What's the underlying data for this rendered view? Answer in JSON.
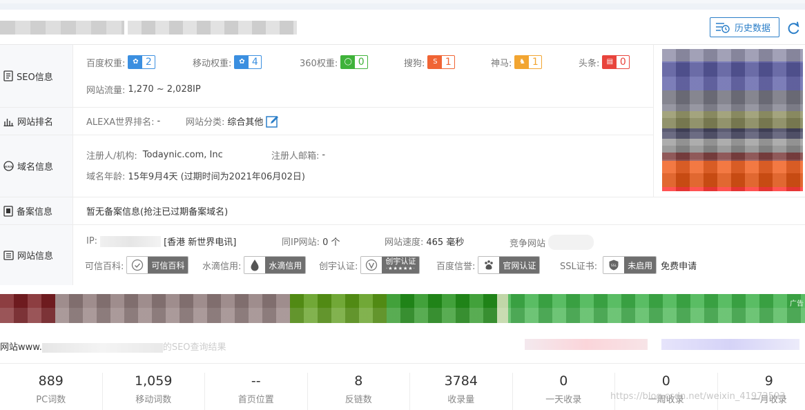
{
  "header": {
    "history_button": "历史数据",
    "icons": {
      "history": "history-list-icon",
      "refresh": "refresh-icon"
    }
  },
  "rows": {
    "seo": {
      "label": "SEO信息",
      "baidu_label": "百度权重:",
      "baidu_value": "2",
      "mobile_label": "移动权重:",
      "mobile_value": "4",
      "r360_label": "360权重:",
      "r360_value": "0",
      "sogou_label": "搜狗:",
      "sogou_value": "1",
      "shenma_label": "神马:",
      "shenma_value": "1",
      "toutiao_label": "头条:",
      "toutiao_value": "0",
      "traffic_label": "网站流量:",
      "traffic_value": "1,270 ~ 2,028IP"
    },
    "ranking": {
      "label": "网站排名",
      "alexa_label": "ALEXA世界排名:",
      "alexa_value": "-",
      "category_label": "网站分类:",
      "category_value": "综合其他"
    },
    "domain": {
      "label": "域名信息",
      "registrant_label": "注册人/机构:",
      "registrant_value": "Todaynic.com, Inc",
      "email_label": "注册人邮箱:",
      "email_value": "-",
      "age_label": "域名年龄:",
      "age_value": "15年9月4天 (过期时间为2021年06月02日)"
    },
    "icp": {
      "label": "备案信息",
      "value": "暂无备案信息(抢注已过期备案域名)"
    },
    "site": {
      "label": "网站信息",
      "ip_label": "IP:",
      "ip_location": "[香港 新世界电讯]",
      "same_ip_label": "同IP网站:",
      "same_ip_value": "0 个",
      "speed_label": "网站速度:",
      "speed_value": "465 毫秒",
      "compete_label": "竞争网站",
      "trust_label": "可信百科:",
      "trust_badge": "可信百科",
      "shuidi_label": "水滴信用:",
      "shuidi_badge": "水滴信用",
      "chuangyu_label": "创宇认证:",
      "chuangyu_badge": "创宇认证",
      "baidu_credit_label": "百度信誉:",
      "baidu_credit_badge": "官网认证",
      "ssl_label": "SSL证书:",
      "ssl_badge": "未启用",
      "ssl_apply": "免费申请"
    }
  },
  "result": {
    "prefix": "网站www.",
    "suffix": "的SEO查询结果"
  },
  "ad": {
    "tag": "广告"
  },
  "stats": [
    {
      "value": "889",
      "label": "PC词数"
    },
    {
      "value": "1,059",
      "label": "移动词数"
    },
    {
      "value": "--",
      "label": "首页位置"
    },
    {
      "value": "8",
      "label": "反链数"
    },
    {
      "value": "3784",
      "label": "收录量"
    },
    {
      "value": "0",
      "label": "一天收录"
    },
    {
      "value": "0",
      "label": "一周收录"
    },
    {
      "value": "9",
      "label": "一月收录"
    }
  ],
  "watermark": "https://blog.csdn.net/weixin_41972593",
  "colors": {
    "accent": "#2a7ec8",
    "baidu": "#3b8fe0",
    "r360": "#3fb23a",
    "sogou": "#f06434",
    "shenma": "#f2a531",
    "toutiao": "#e8443c"
  }
}
